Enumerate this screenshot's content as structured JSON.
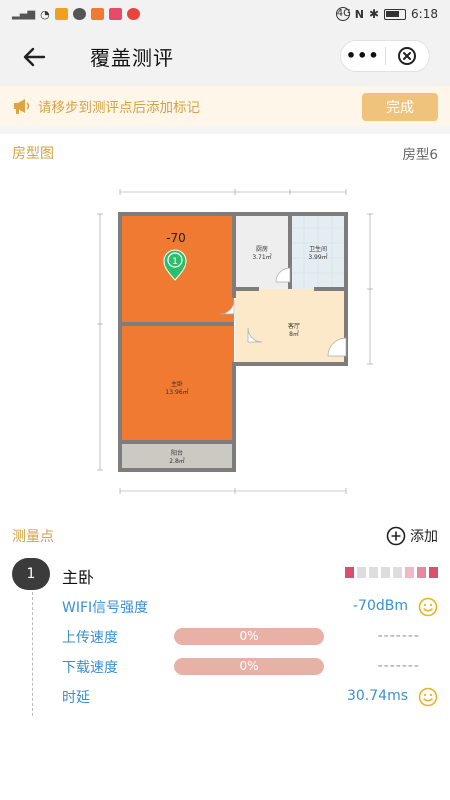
{
  "status_bar": {
    "time": "6:18",
    "signal_text": "4G"
  },
  "nav": {
    "title": "覆盖测评"
  },
  "notice": {
    "text": "请移步到测评点后添加标记",
    "done_label": "完成"
  },
  "floorplan_section": {
    "title": "房型图",
    "type_label": "房型6",
    "marker_value": "-70",
    "marker_number": "1",
    "rooms": {
      "kitchen": "厨房",
      "kitchen_area": "3.71㎡",
      "bathroom": "卫生间",
      "bathroom_area": "3.99㎡",
      "living": "客厅",
      "living_area": "8㎡",
      "bedroom": "主卧",
      "bedroom_area": "13.96㎡",
      "balcony": "阳台",
      "balcony_area": "2.8㎡"
    }
  },
  "measure_section": {
    "title": "测量点",
    "add_label": "添加"
  },
  "point": {
    "index": "1",
    "name": "主卧",
    "signal_colors": [
      "#d94f6e",
      "#dddddd",
      "#dddddd",
      "#dddddd",
      "#dddddd",
      "#f2b8c6",
      "#e889a2",
      "#d94f6e"
    ],
    "metrics": {
      "wifi_label": "WIFI信号强度",
      "wifi_value": "-70dBm",
      "upload_label": "上传速度",
      "upload_percent": "0%",
      "upload_progress": 0,
      "upload_value": "-------",
      "download_label": "下载速度",
      "download_percent": "0%",
      "download_progress": 0,
      "download_value": "-------",
      "latency_label": "时延",
      "latency_value": "30.74ms"
    }
  },
  "colors": {
    "accent": "#d6a243",
    "metric": "#3a8fd6",
    "room_orange": "#f07a32",
    "marker_green": "#2bbf6a"
  }
}
